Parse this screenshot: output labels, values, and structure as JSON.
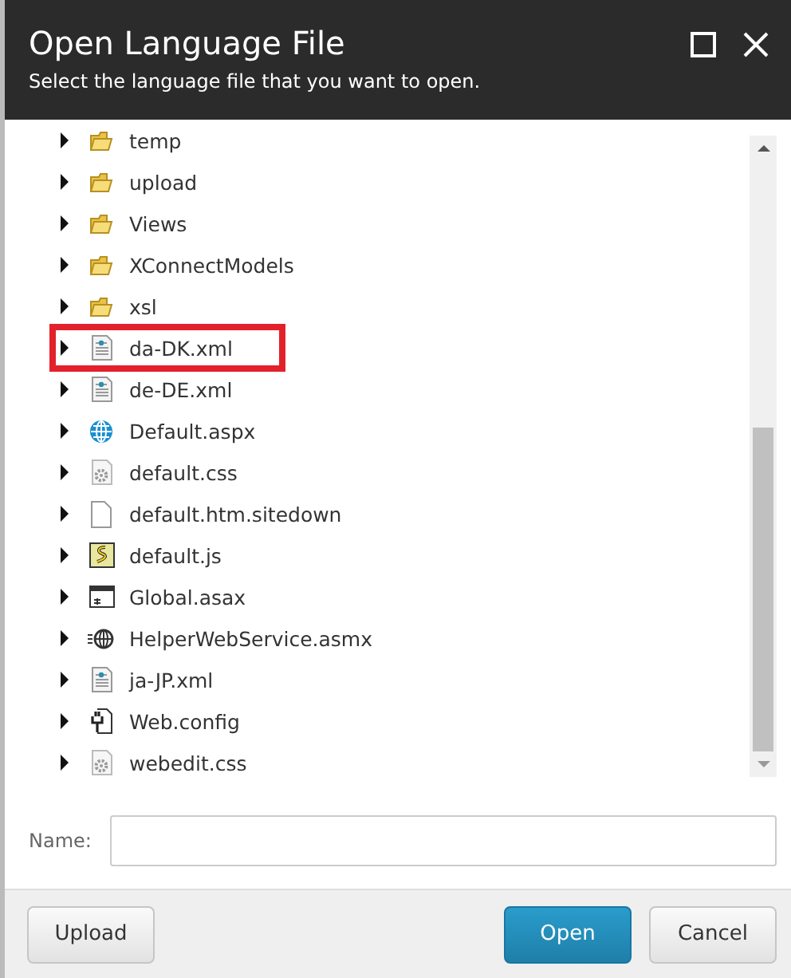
{
  "window": {
    "title": "Open Language File",
    "subtitle": "Select the language file that you want to open."
  },
  "tree": [
    {
      "label": "temp",
      "kind": "folder",
      "highlighted": false
    },
    {
      "label": "upload",
      "kind": "folder",
      "highlighted": false
    },
    {
      "label": "Views",
      "kind": "folder",
      "highlighted": false
    },
    {
      "label": "XConnectModels",
      "kind": "folder",
      "highlighted": false
    },
    {
      "label": "xsl",
      "kind": "folder",
      "highlighted": false
    },
    {
      "label": "da-DK.xml",
      "kind": "xml",
      "highlighted": true
    },
    {
      "label": "de-DE.xml",
      "kind": "xml",
      "highlighted": false
    },
    {
      "label": "Default.aspx",
      "kind": "web",
      "highlighted": false
    },
    {
      "label": "default.css",
      "kind": "css",
      "highlighted": false
    },
    {
      "label": "default.htm.sitedown",
      "kind": "blank",
      "highlighted": false
    },
    {
      "label": "default.js",
      "kind": "js",
      "highlighted": false
    },
    {
      "label": "Global.asax",
      "kind": "asax",
      "highlighted": false
    },
    {
      "label": "HelperWebService.asmx",
      "kind": "asmx",
      "highlighted": false
    },
    {
      "label": "ja-JP.xml",
      "kind": "xml",
      "highlighted": false
    },
    {
      "label": "Web.config",
      "kind": "config",
      "highlighted": false
    },
    {
      "label": "webedit.css",
      "kind": "css",
      "highlighted": false
    }
  ],
  "name_field": {
    "label": "Name:"
  },
  "buttons": [
    {
      "label": "Upload",
      "kind": "secondary"
    },
    {
      "label": "Open",
      "kind": "primary"
    },
    {
      "label": "Cancel",
      "kind": "secondary"
    }
  ]
}
